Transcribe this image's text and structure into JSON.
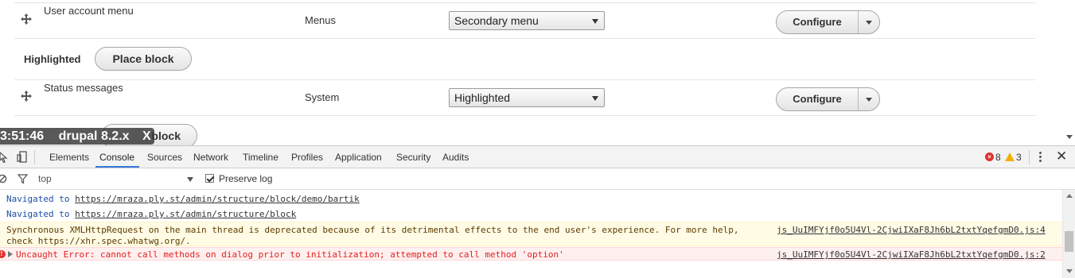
{
  "page": {
    "rows": [
      {
        "title": "User account menu",
        "category": "Menus",
        "region": "Secondary menu",
        "configure": "Configure"
      },
      {
        "title": "Status messages",
        "category": "System",
        "region": "Highlighted",
        "configure": "Configure"
      }
    ],
    "region_highlighted": {
      "label": "Highlighted",
      "place_block": "Place block"
    },
    "partial_place_block": "block",
    "icons": {
      "drag": "move-arrows-icon"
    }
  },
  "badge": {
    "time": "3:51:46",
    "project": "drupal 8.2.x",
    "close": "X"
  },
  "devtools": {
    "tabs": [
      "Elements",
      "Console",
      "Sources",
      "Network",
      "Timeline",
      "Profiles",
      "Application",
      "Security",
      "Audits"
    ],
    "active_tab": "Console",
    "error_count": "8",
    "warning_count": "3",
    "filter": {
      "context": "top",
      "preserve_log_label": "Preserve log",
      "preserve_log_checked": true
    },
    "messages": [
      {
        "type": "info",
        "prefix": "Navigated to ",
        "link": "https://mraza.ply.st/admin/structure/block/demo/bartik"
      },
      {
        "type": "info",
        "prefix": "Navigated to ",
        "link": "https://mraza.ply.st/admin/structure/block"
      },
      {
        "type": "warning",
        "line1": "Synchronous XMLHttpRequest on the main thread is deprecated because of its detrimental effects to the end user's experience. For more help,",
        "line2": "check https://xhr.spec.whatwg.org/.",
        "source": "js_UuIMFYjf0o5U4Vl-2CjwiIXaF8Jh6bL2txtYqefgmD0.js:4"
      },
      {
        "type": "error",
        "text": "Uncaught Error: cannot call methods on dialog prior to initialization; attempted to call method 'option'",
        "source": "js_UuIMFYjf0o5U4Vl-2CjwiIXaF8Jh6bL2txtYqefgmD0.js:2"
      }
    ]
  },
  "colors": {
    "accent": "#3879d9",
    "error": "#e0312e",
    "warning": "#f1b000"
  }
}
